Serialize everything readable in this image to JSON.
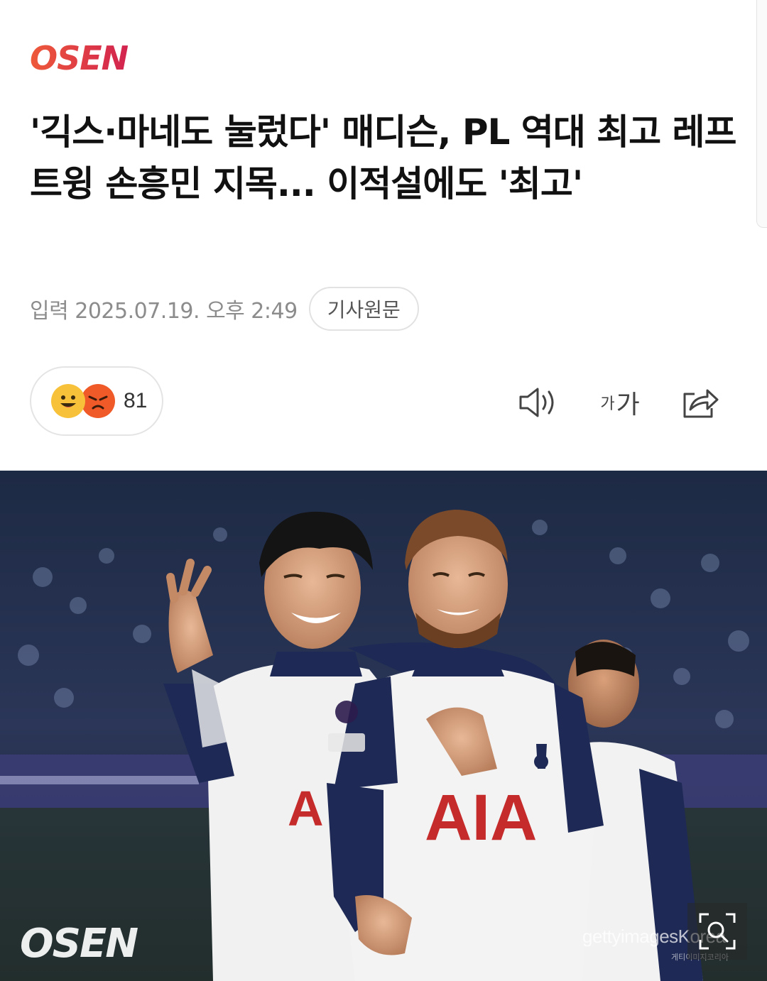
{
  "publisher": {
    "logo_text": "OSEN",
    "logo_colors": [
      "#e84a3b",
      "#d6234f"
    ]
  },
  "article": {
    "headline": "'긱스·마네도 눌렀다' 매디슨, PL 역대 최고 레프트윙 손흥민 지목... 이적설에도 '최고'",
    "date_text": "입력 2025.07.19. 오후 2:49",
    "original_link_label": "기사원문"
  },
  "reactions": {
    "count": "81",
    "icons": [
      "smile-emoji-icon",
      "angry-emoji-icon"
    ]
  },
  "toolbar": {
    "tts_icon": "speaker-icon",
    "font_small": "가",
    "font_large": "가",
    "share_icon": "share-icon"
  },
  "photo": {
    "watermark_logo": "OSEN",
    "credit": "gettyimagesKorea",
    "credit_sub": "게티이미지코리아",
    "zoom_icon": "zoom-icon"
  }
}
